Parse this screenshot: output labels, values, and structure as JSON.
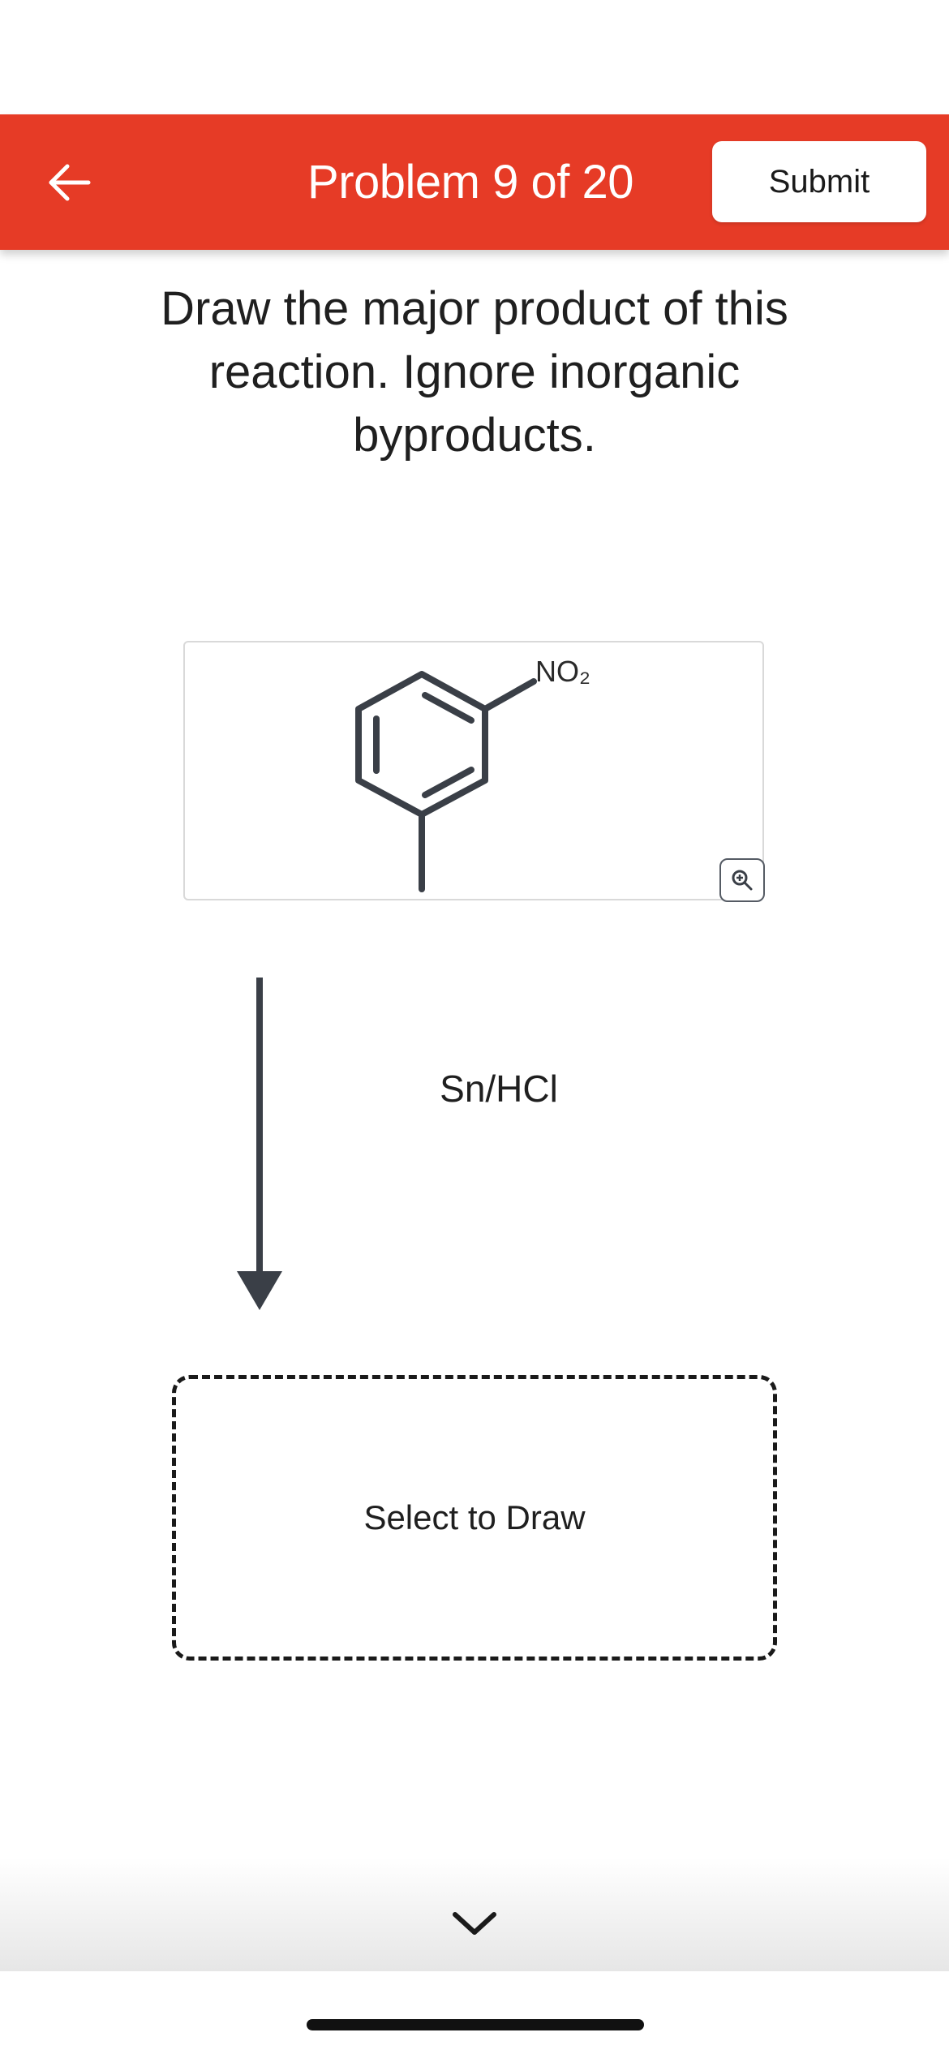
{
  "header": {
    "title": "Problem 9 of 20",
    "submit_label": "Submit",
    "background_color": "#e63b26"
  },
  "question": {
    "text": "Draw the major product of this reaction. Ignore inorganic byproducts."
  },
  "reactant": {
    "substituent_label": "NO₂",
    "zoom_icon": "zoom-in-icon"
  },
  "reaction": {
    "reagent": "Sn/HCl"
  },
  "answer": {
    "placeholder": "Select to Draw"
  },
  "icons": {
    "back": "arrow-left-icon",
    "scroll": "chevron-down-icon"
  }
}
